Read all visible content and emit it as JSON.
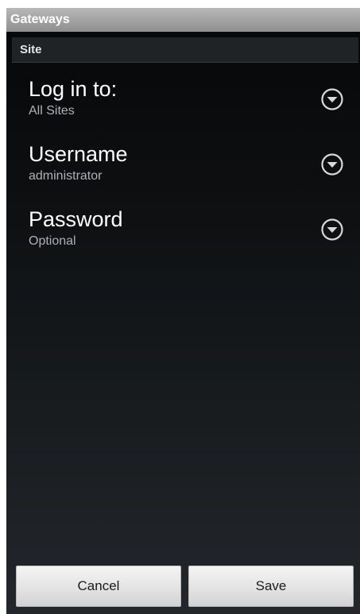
{
  "window": {
    "title": "Gateways"
  },
  "section": {
    "header": "Site"
  },
  "preferences": [
    {
      "title": "Log in to:",
      "summary": "All Sites",
      "icon": "chevron-down-circle-icon"
    },
    {
      "title": "Username",
      "summary": "administrator",
      "icon": "chevron-down-circle-icon"
    },
    {
      "title": "Password",
      "summary": "Optional",
      "icon": "chevron-down-circle-icon"
    }
  ],
  "buttons": {
    "cancel_label": "Cancel",
    "save_label": "Save"
  },
  "colors": {
    "title_bar": "#9e9e9e",
    "background_top": "#060709",
    "background_bottom": "#23272b",
    "section_header": "#1f2326",
    "summary_text": "#aeb1b4",
    "button_face": "#e6e6e6"
  }
}
